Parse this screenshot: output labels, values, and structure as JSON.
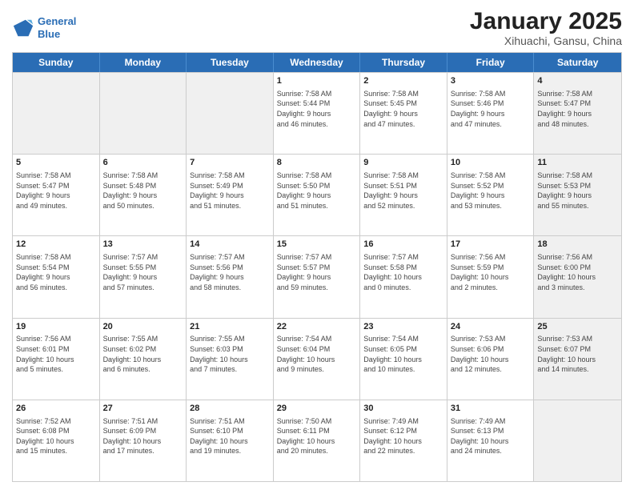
{
  "header": {
    "logo_line1": "General",
    "logo_line2": "Blue",
    "title": "January 2025",
    "subtitle": "Xihuachi, Gansu, China"
  },
  "weekdays": [
    "Sunday",
    "Monday",
    "Tuesday",
    "Wednesday",
    "Thursday",
    "Friday",
    "Saturday"
  ],
  "weeks": [
    [
      {
        "day": "",
        "info": "",
        "shaded": true
      },
      {
        "day": "",
        "info": "",
        "shaded": true
      },
      {
        "day": "",
        "info": "",
        "shaded": true
      },
      {
        "day": "1",
        "info": "Sunrise: 7:58 AM\nSunset: 5:44 PM\nDaylight: 9 hours\nand 46 minutes.",
        "shaded": false
      },
      {
        "day": "2",
        "info": "Sunrise: 7:58 AM\nSunset: 5:45 PM\nDaylight: 9 hours\nand 47 minutes.",
        "shaded": false
      },
      {
        "day": "3",
        "info": "Sunrise: 7:58 AM\nSunset: 5:46 PM\nDaylight: 9 hours\nand 47 minutes.",
        "shaded": false
      },
      {
        "day": "4",
        "info": "Sunrise: 7:58 AM\nSunset: 5:47 PM\nDaylight: 9 hours\nand 48 minutes.",
        "shaded": true
      }
    ],
    [
      {
        "day": "5",
        "info": "Sunrise: 7:58 AM\nSunset: 5:47 PM\nDaylight: 9 hours\nand 49 minutes.",
        "shaded": false
      },
      {
        "day": "6",
        "info": "Sunrise: 7:58 AM\nSunset: 5:48 PM\nDaylight: 9 hours\nand 50 minutes.",
        "shaded": false
      },
      {
        "day": "7",
        "info": "Sunrise: 7:58 AM\nSunset: 5:49 PM\nDaylight: 9 hours\nand 51 minutes.",
        "shaded": false
      },
      {
        "day": "8",
        "info": "Sunrise: 7:58 AM\nSunset: 5:50 PM\nDaylight: 9 hours\nand 51 minutes.",
        "shaded": false
      },
      {
        "day": "9",
        "info": "Sunrise: 7:58 AM\nSunset: 5:51 PM\nDaylight: 9 hours\nand 52 minutes.",
        "shaded": false
      },
      {
        "day": "10",
        "info": "Sunrise: 7:58 AM\nSunset: 5:52 PM\nDaylight: 9 hours\nand 53 minutes.",
        "shaded": false
      },
      {
        "day": "11",
        "info": "Sunrise: 7:58 AM\nSunset: 5:53 PM\nDaylight: 9 hours\nand 55 minutes.",
        "shaded": true
      }
    ],
    [
      {
        "day": "12",
        "info": "Sunrise: 7:58 AM\nSunset: 5:54 PM\nDaylight: 9 hours\nand 56 minutes.",
        "shaded": false
      },
      {
        "day": "13",
        "info": "Sunrise: 7:57 AM\nSunset: 5:55 PM\nDaylight: 9 hours\nand 57 minutes.",
        "shaded": false
      },
      {
        "day": "14",
        "info": "Sunrise: 7:57 AM\nSunset: 5:56 PM\nDaylight: 9 hours\nand 58 minutes.",
        "shaded": false
      },
      {
        "day": "15",
        "info": "Sunrise: 7:57 AM\nSunset: 5:57 PM\nDaylight: 9 hours\nand 59 minutes.",
        "shaded": false
      },
      {
        "day": "16",
        "info": "Sunrise: 7:57 AM\nSunset: 5:58 PM\nDaylight: 10 hours\nand 0 minutes.",
        "shaded": false
      },
      {
        "day": "17",
        "info": "Sunrise: 7:56 AM\nSunset: 5:59 PM\nDaylight: 10 hours\nand 2 minutes.",
        "shaded": false
      },
      {
        "day": "18",
        "info": "Sunrise: 7:56 AM\nSunset: 6:00 PM\nDaylight: 10 hours\nand 3 minutes.",
        "shaded": true
      }
    ],
    [
      {
        "day": "19",
        "info": "Sunrise: 7:56 AM\nSunset: 6:01 PM\nDaylight: 10 hours\nand 5 minutes.",
        "shaded": false
      },
      {
        "day": "20",
        "info": "Sunrise: 7:55 AM\nSunset: 6:02 PM\nDaylight: 10 hours\nand 6 minutes.",
        "shaded": false
      },
      {
        "day": "21",
        "info": "Sunrise: 7:55 AM\nSunset: 6:03 PM\nDaylight: 10 hours\nand 7 minutes.",
        "shaded": false
      },
      {
        "day": "22",
        "info": "Sunrise: 7:54 AM\nSunset: 6:04 PM\nDaylight: 10 hours\nand 9 minutes.",
        "shaded": false
      },
      {
        "day": "23",
        "info": "Sunrise: 7:54 AM\nSunset: 6:05 PM\nDaylight: 10 hours\nand 10 minutes.",
        "shaded": false
      },
      {
        "day": "24",
        "info": "Sunrise: 7:53 AM\nSunset: 6:06 PM\nDaylight: 10 hours\nand 12 minutes.",
        "shaded": false
      },
      {
        "day": "25",
        "info": "Sunrise: 7:53 AM\nSunset: 6:07 PM\nDaylight: 10 hours\nand 14 minutes.",
        "shaded": true
      }
    ],
    [
      {
        "day": "26",
        "info": "Sunrise: 7:52 AM\nSunset: 6:08 PM\nDaylight: 10 hours\nand 15 minutes.",
        "shaded": false
      },
      {
        "day": "27",
        "info": "Sunrise: 7:51 AM\nSunset: 6:09 PM\nDaylight: 10 hours\nand 17 minutes.",
        "shaded": false
      },
      {
        "day": "28",
        "info": "Sunrise: 7:51 AM\nSunset: 6:10 PM\nDaylight: 10 hours\nand 19 minutes.",
        "shaded": false
      },
      {
        "day": "29",
        "info": "Sunrise: 7:50 AM\nSunset: 6:11 PM\nDaylight: 10 hours\nand 20 minutes.",
        "shaded": false
      },
      {
        "day": "30",
        "info": "Sunrise: 7:49 AM\nSunset: 6:12 PM\nDaylight: 10 hours\nand 22 minutes.",
        "shaded": false
      },
      {
        "day": "31",
        "info": "Sunrise: 7:49 AM\nSunset: 6:13 PM\nDaylight: 10 hours\nand 24 minutes.",
        "shaded": false
      },
      {
        "day": "",
        "info": "",
        "shaded": true
      }
    ]
  ]
}
